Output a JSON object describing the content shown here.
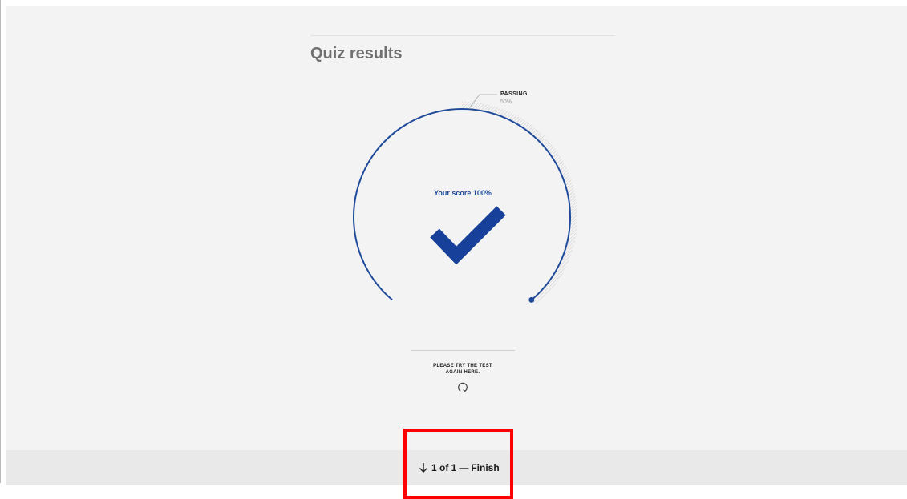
{
  "quiz": {
    "title": "Quiz results",
    "passing_label": "PASSING",
    "passing_value": "50%",
    "score_text": "Your score 100%",
    "score_fraction": 1.0,
    "passing_fraction": 0.5,
    "retry_text": "PLEASE TRY THE TEST\nAGAIN HERE."
  },
  "footer": {
    "progress": "1 of 1",
    "separator": "—",
    "finish_label": "Finish"
  },
  "colors": {
    "accent": "#1f4a9a",
    "checkmark": "#17409a",
    "highlight": "#ff0000",
    "background": "#f3f3f3"
  },
  "icons": {
    "check": "checkmark-icon",
    "retry": "retry-icon",
    "arrow": "arrow-down-icon"
  }
}
